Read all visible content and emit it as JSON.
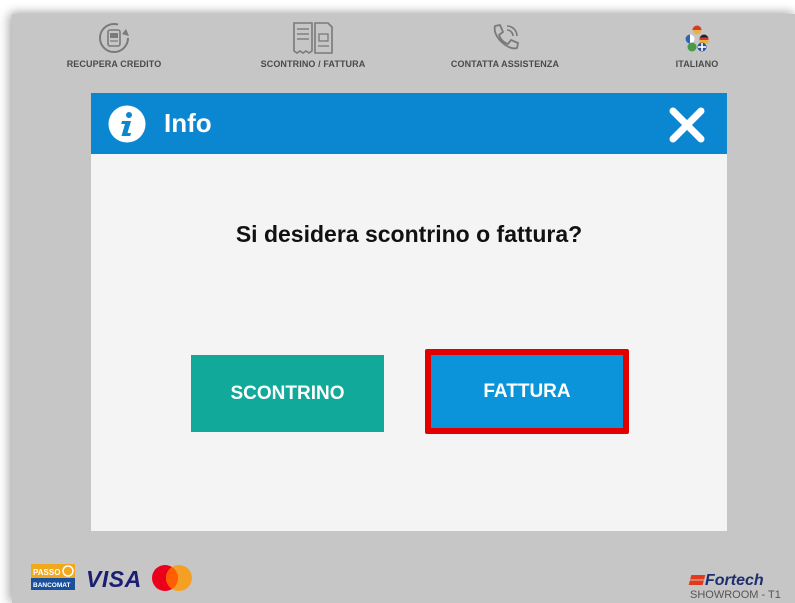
{
  "topnav": {
    "items": [
      {
        "label": "RECUPERA CREDITO",
        "icon": "refund-card-icon"
      },
      {
        "label": "SCONTRINO / FATTURA",
        "icon": "receipt-invoice-icon"
      },
      {
        "label": "CONTATTA ASSISTENZA",
        "icon": "phone-assistance-icon"
      },
      {
        "label": "ITALIANO",
        "icon": "language-flags-icon"
      }
    ]
  },
  "dialog": {
    "title": "Info",
    "title_icon": "info-icon",
    "close_icon": "close-icon",
    "question": "Si desidera scontrino o fattura?",
    "buttons": {
      "scontrino": "SCONTRINO",
      "fattura": "FATTURA"
    }
  },
  "footer": {
    "payment_methods": {
      "bancomat_top": "PASSO",
      "bancomat_bottom": "BANCOMAT",
      "visa": "VISA",
      "mastercard": "mastercard-icon"
    },
    "brand": "Fortech",
    "location": "SHOWROOM - T1"
  },
  "colors": {
    "header_blue": "#0a87d0",
    "scontrino_green": "#10a99a",
    "fattura_blue": "#0c94da",
    "highlight_red": "#e30000",
    "overlay_gray": "#c6c6c6"
  }
}
